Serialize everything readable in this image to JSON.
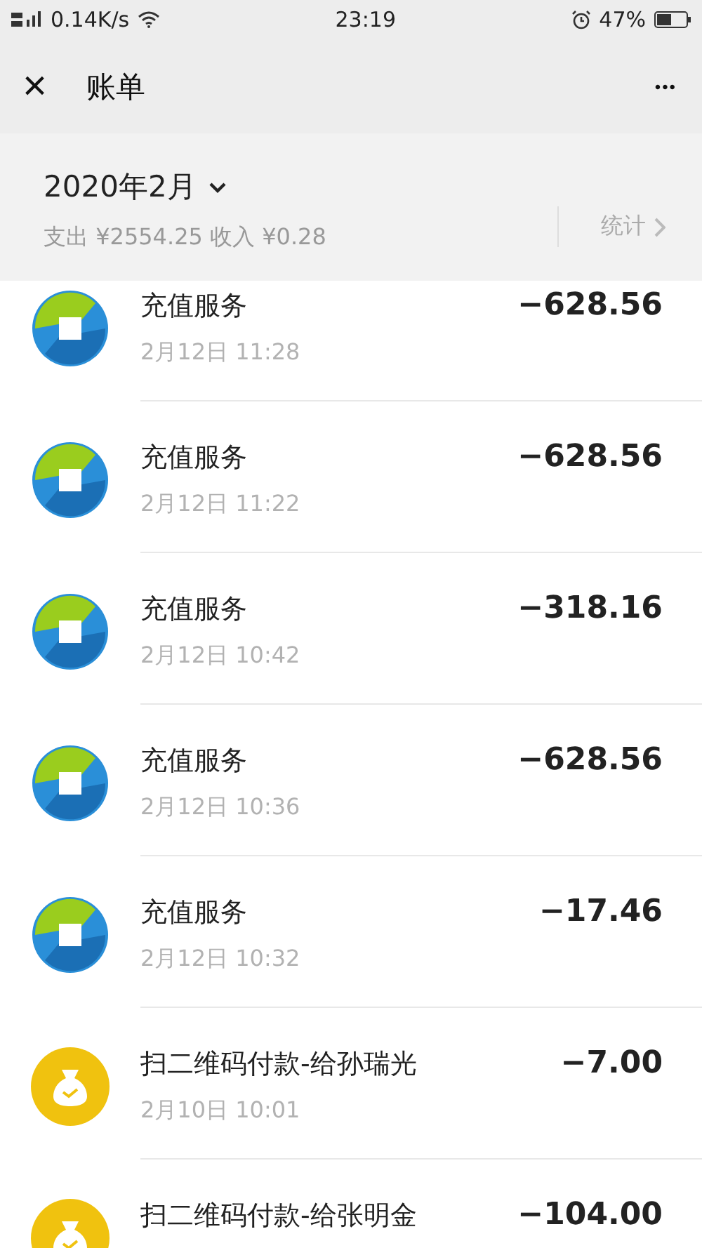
{
  "status_bar": {
    "network": "0.14K/s",
    "time": "23:19",
    "battery": "47%"
  },
  "title_bar": {
    "close": "×",
    "title": "账单",
    "more": "•••"
  },
  "summary": {
    "month": "2020年2月",
    "totals": "支出 ¥2554.25 收入 ¥0.28",
    "stats_link": "统计"
  },
  "transactions": [
    {
      "kind": "recharge",
      "title": "充值服务",
      "time": "2月12日 11:28",
      "amount": "−628.56"
    },
    {
      "kind": "recharge",
      "title": "充值服务",
      "time": "2月12日 11:22",
      "amount": "−628.56"
    },
    {
      "kind": "recharge",
      "title": "充值服务",
      "time": "2月12日 10:42",
      "amount": "−318.16"
    },
    {
      "kind": "recharge",
      "title": "充值服务",
      "time": "2月12日 10:36",
      "amount": "−628.56"
    },
    {
      "kind": "recharge",
      "title": "充值服务",
      "time": "2月12日 10:32",
      "amount": "−17.46"
    },
    {
      "kind": "qr_payment",
      "title": "扫二维码付款-给孙瑞光",
      "time": "2月10日 10:01",
      "amount": "−7.00"
    },
    {
      "kind": "qr_payment",
      "title": "扫二维码付款-给张明金",
      "amount": "−104.00"
    }
  ]
}
